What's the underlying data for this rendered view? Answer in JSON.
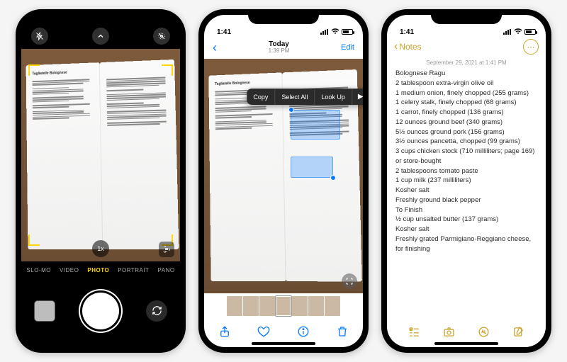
{
  "phone1": {
    "top_icons": {
      "flash": "flash-off",
      "chevron": "chevron-up",
      "live": "liveraw-off"
    },
    "book_title": "Tagliatelle Bolognese",
    "zoom_label": "1x",
    "modes": [
      "SLO-MO",
      "VIDEO",
      "PHOTO",
      "PORTRAIT",
      "PANO"
    ],
    "active_mode": "PHOTO"
  },
  "phone2": {
    "status_time": "1:41",
    "nav": {
      "title": "Today",
      "subtitle": "1:39 PM",
      "edit": "Edit"
    },
    "book_title": "Tagliatelle Bolognese",
    "popover": {
      "copy": "Copy",
      "select_all": "Select All",
      "look_up": "Look Up"
    },
    "toolbar": {
      "share": "share",
      "heart": "heart",
      "info": "info",
      "trash": "trash"
    }
  },
  "phone3": {
    "status_time": "1:41",
    "back_label": "Notes",
    "timestamp": "September 29, 2021 at 1:41 PM",
    "lines": [
      "Bolognese Ragu",
      "2 tablespoon extra-virgin olive oil",
      "1 medium onion, finely chopped (255 grams)",
      "1 celery stalk, finely chopped (68 grams)",
      "1 carrot, finely chopped (136 grams)",
      "12 ounces ground beef (340 grams)",
      "5½ ounces ground pork (156 grams)",
      "3½ ounces pancetta, chopped (99 grams)",
      "3 cups chicken stock (710 milliliters; page 169) or store-bought",
      "2 tablespoons tomato paste",
      "1 cup milk (237 milliliters)",
      "Kosher salt",
      "Freshly ground black pepper",
      "To Finish",
      "½ cup unsalted butter (137 grams)",
      "Kosher salt",
      "Freshly grated Parmigiano-Reggiano cheese, for finishing"
    ],
    "toolbar": {
      "checklist": "checklist",
      "camera": "camera",
      "marker": "marker",
      "compose": "compose"
    }
  }
}
